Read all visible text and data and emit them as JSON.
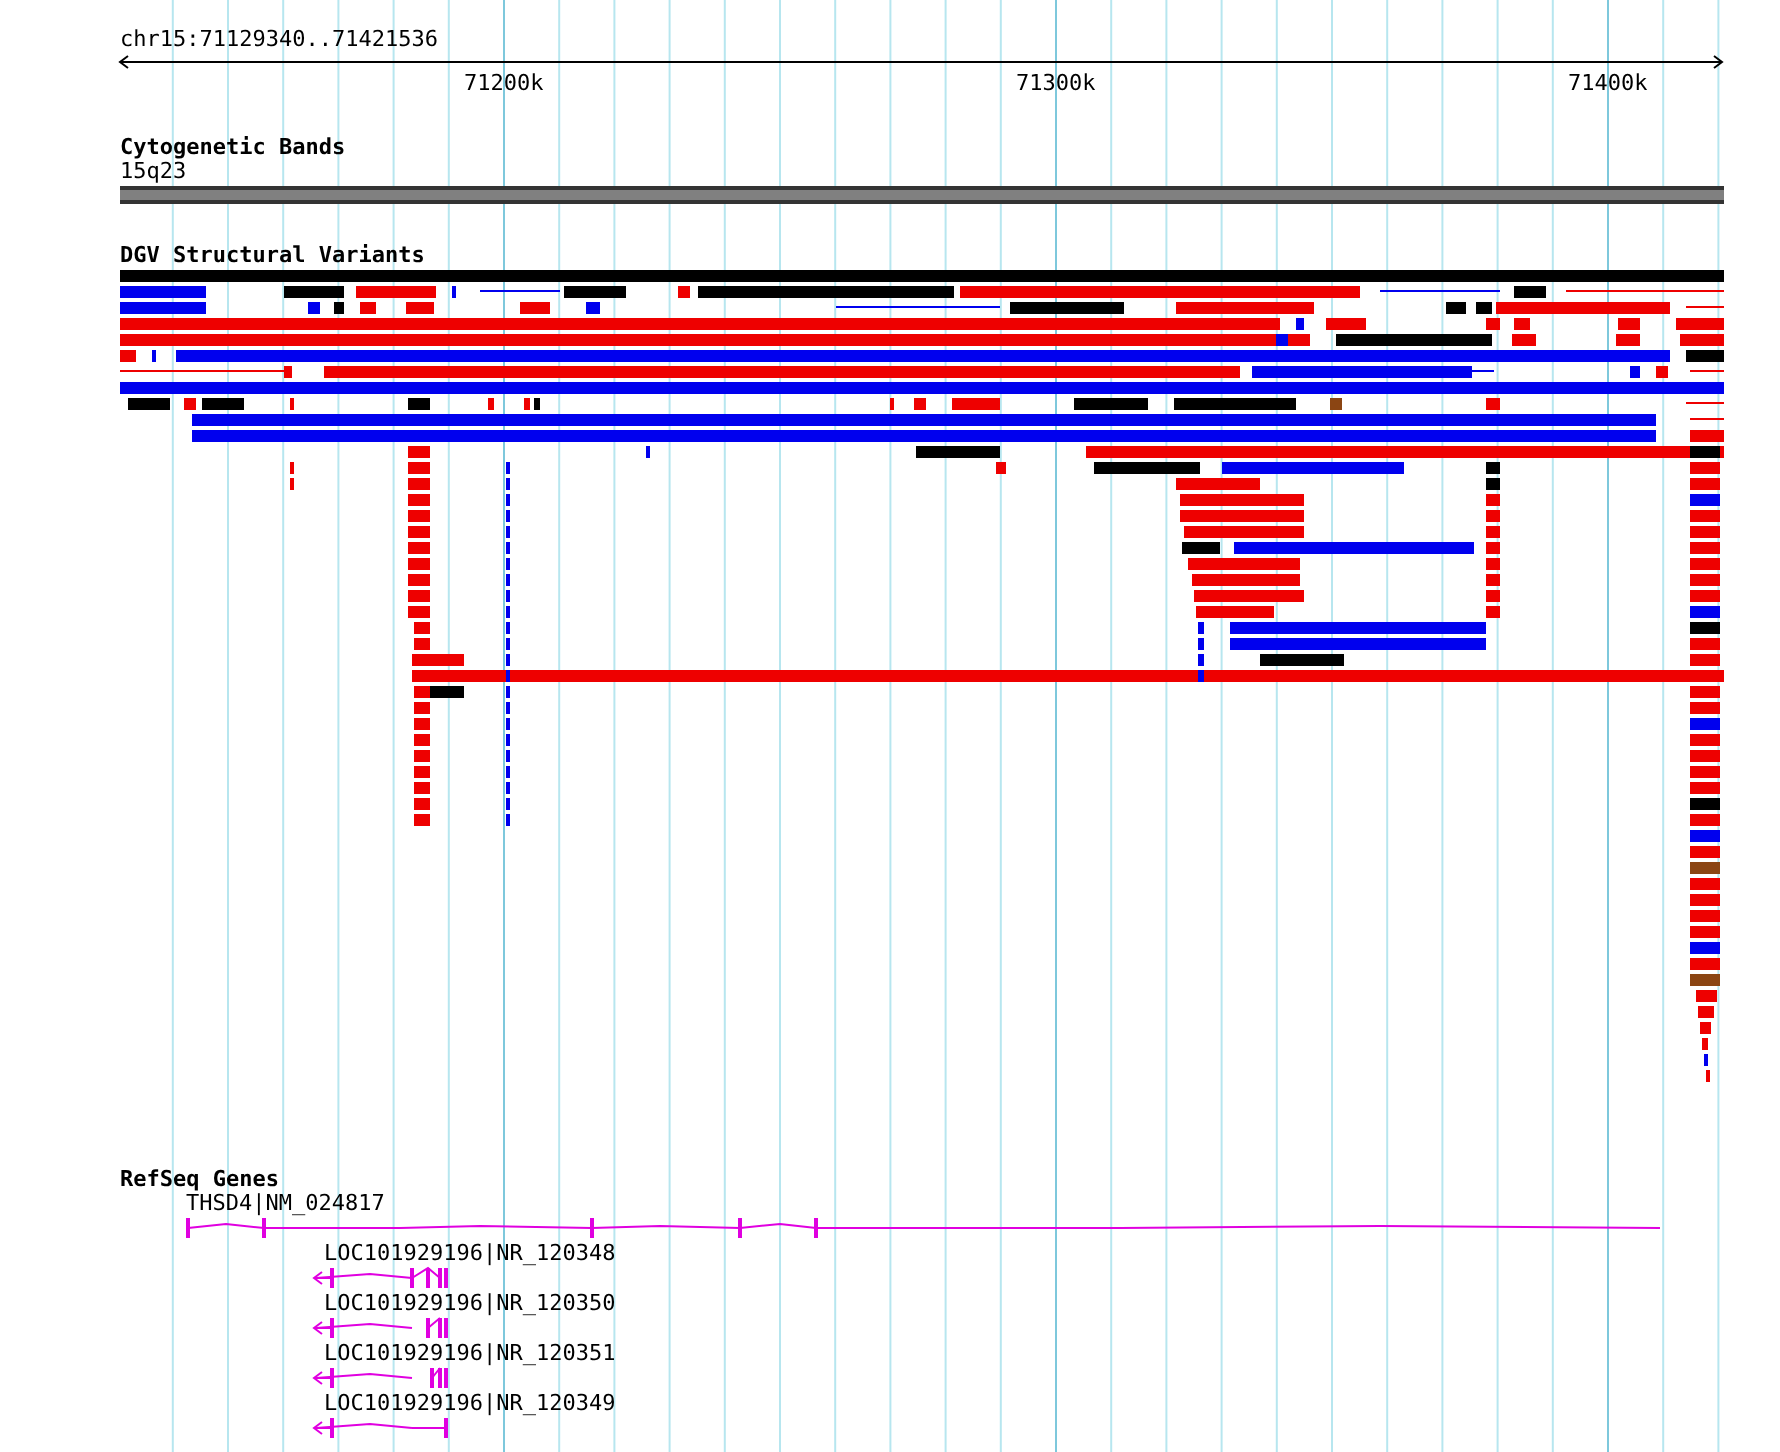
{
  "ruler": {
    "location": "chr15:71129340..71421536",
    "ticks": [
      "71200k",
      "71300k",
      "71400k"
    ]
  },
  "tracks": [
    {
      "kind": "cytoband",
      "title": "Cytogenetic Bands",
      "feature_label": "15q23"
    },
    {
      "kind": "variants",
      "title": "DGV Structural Variants"
    },
    {
      "kind": "genes",
      "title": "RefSeq Genes",
      "genes": [
        {
          "kind": "main",
          "label": "THSD4|NM_024817"
        },
        {
          "kind": "transcript",
          "label": "LOC101929196|NR_120348"
        },
        {
          "kind": "transcript",
          "label": "LOC101929196|NR_120350"
        },
        {
          "kind": "transcript",
          "label": "LOC101929196|NR_120351"
        },
        {
          "kind": "transcript",
          "label": "LOC101929196|NR_120349"
        }
      ]
    }
  ]
}
